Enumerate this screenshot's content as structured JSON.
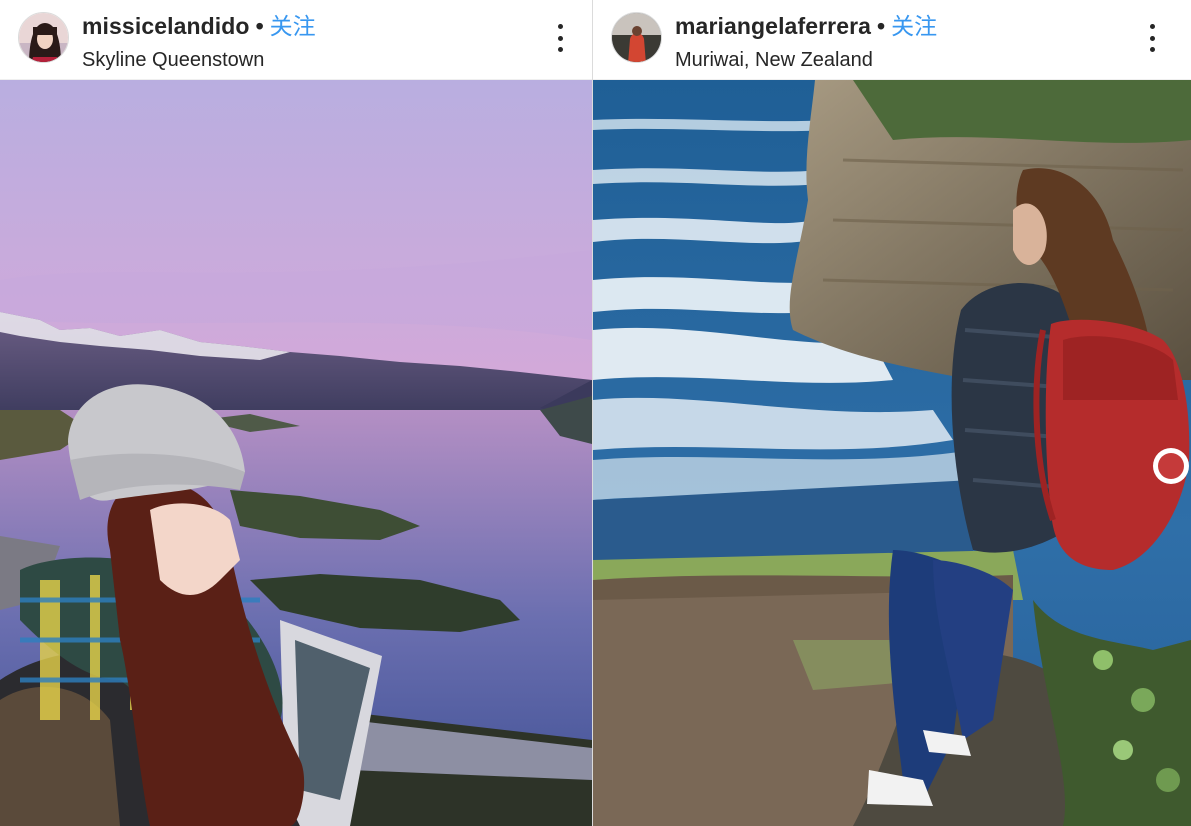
{
  "posts": [
    {
      "username": "missicelandido",
      "separator": "•",
      "follow_label": "关注",
      "location": "Skyline Queenstown",
      "more_icon": "more-vertical-icon",
      "photo_icon": "photo",
      "avatar_icon": "avatar"
    },
    {
      "username": "mariangelaferrera",
      "separator": "•",
      "follow_label": "关注",
      "location": "Muriwai, New Zealand",
      "more_icon": "more-vertical-icon",
      "photo_icon": "photo",
      "avatar_icon": "avatar"
    }
  ],
  "colors": {
    "follow_blue": "#3897f0",
    "text_dark": "#262626",
    "divider": "#dbdbdb"
  }
}
